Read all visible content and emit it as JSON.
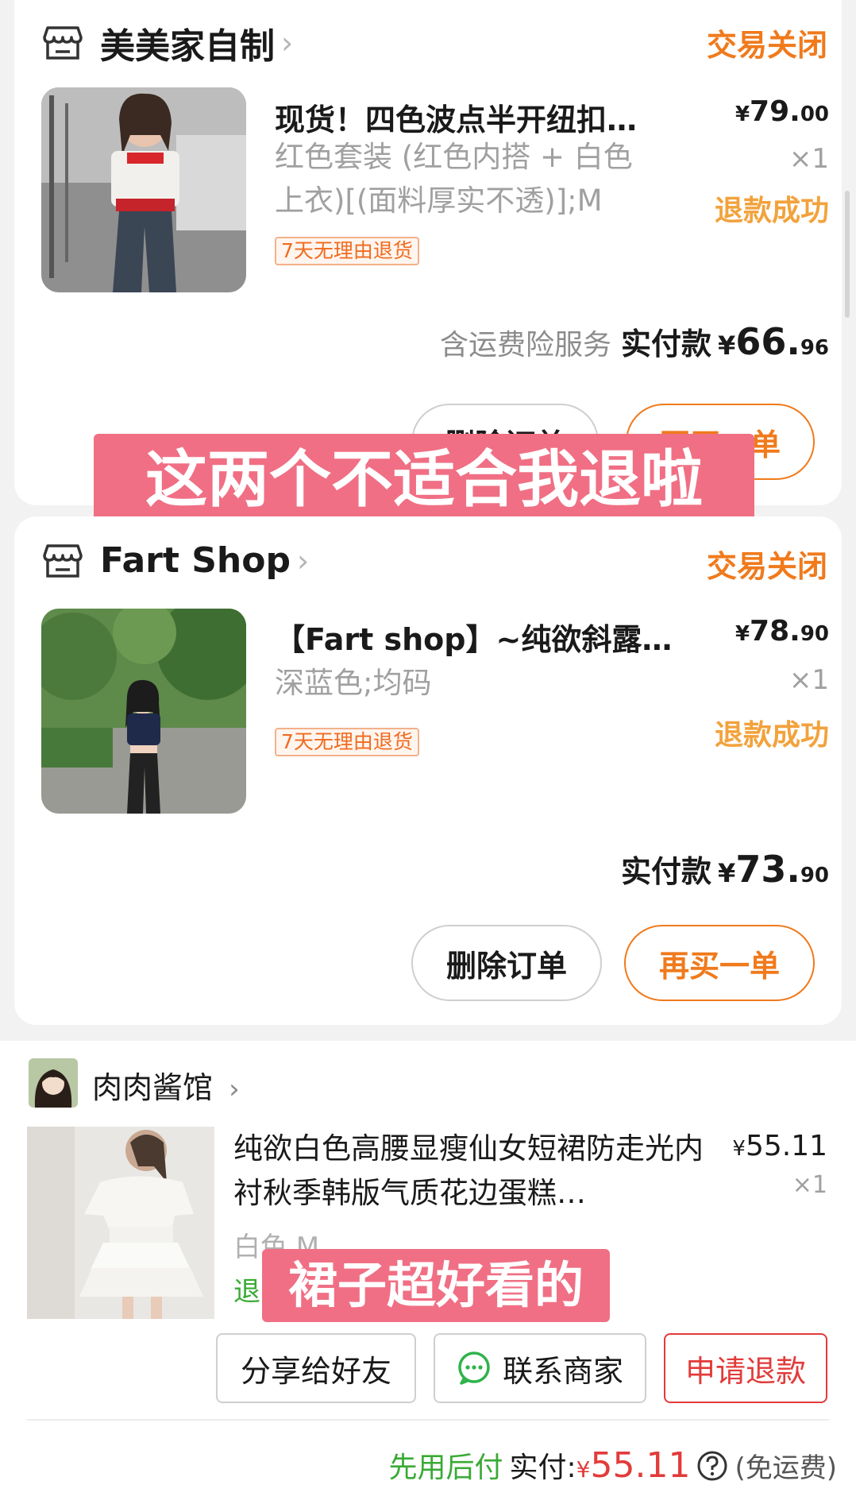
{
  "orders": [
    {
      "shop_name": "美美家自制",
      "status": "交易关闭",
      "product_title": "现货！四色波点半开纽扣…",
      "sku_lines": [
        "红色套装 (红色内搭 + 白色",
        "上衣)[(面料厚实不透)];M"
      ],
      "return_tag": "7天无理由退货",
      "price_yen": "¥",
      "price_int": "79.",
      "price_dec": "00",
      "qty": "×1",
      "refund_status": "退款成功",
      "insurance_text": "含运费险服务",
      "total_label": "实付款",
      "total_yen": "¥",
      "total_int": "66.",
      "total_dec": "96",
      "delete_label": "删除订单",
      "rebuy_label": "再买一单"
    },
    {
      "shop_name": "Fart Shop",
      "status": "交易关闭",
      "product_title": "【Fart shop】~纯欲斜露…",
      "sku": "深蓝色;均码",
      "return_tag": "7天无理由退货",
      "price_yen": "¥",
      "price_int": "78.",
      "price_dec": "90",
      "qty": "×1",
      "refund_status": "退款成功",
      "total_label": "实付款",
      "total_yen": "¥",
      "total_int": "73.",
      "total_dec": "90",
      "delete_label": "删除订单",
      "rebuy_label": "再买一单"
    }
  ],
  "overlays": {
    "top": "这两个不适合我退啦",
    "bottom": "裙子超好看的"
  },
  "order3": {
    "shop_name": "肉肉酱馆",
    "product_title": "纯欲白色高腰显瘦仙女短裙防走光内衬秋季韩版气质花边蛋糕…",
    "price_yen": "¥",
    "price": "55.11",
    "qty": "×1",
    "sku": "白色,M",
    "status_fragment": "退",
    "share_label": "分享给好友",
    "contact_label": "联系商家",
    "refund_label": "申请退款",
    "pay_later": "先用后付",
    "paid_label": "实付:",
    "paid_yen": "¥",
    "paid_amount": "55.11",
    "free_shipping": "(免运费)"
  },
  "colors": {
    "accent_orange": "#f07a1c",
    "refund_gold": "#f2a23c",
    "overlay_pink": "#f06f84",
    "pay_red": "#e23b3b",
    "pay_green": "#3aaa35"
  },
  "icons": [
    "store-icon",
    "chevron-right-icon",
    "chat-bubble-icon",
    "help-circle-icon"
  ]
}
